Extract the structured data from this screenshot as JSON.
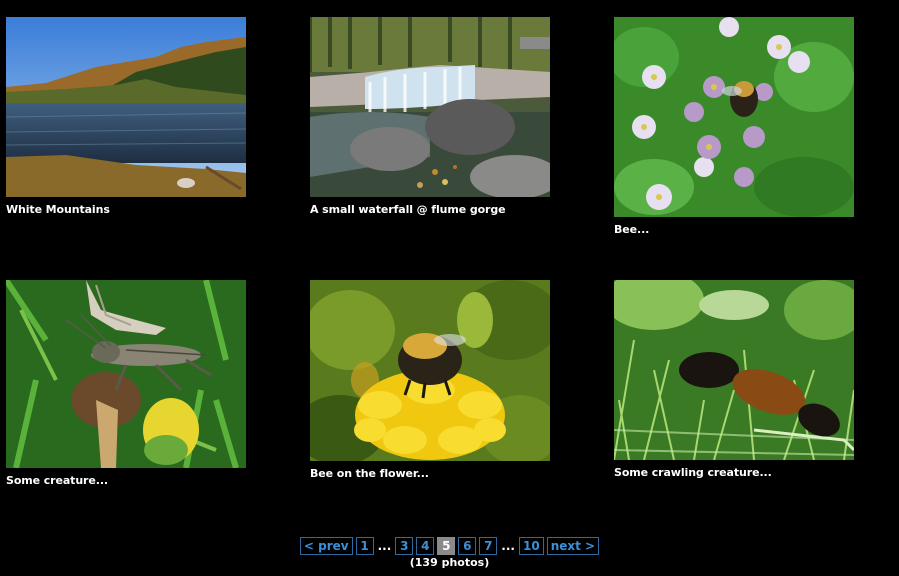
{
  "photos": [
    {
      "caption": "White Mountains",
      "alt": "Lake with autumn foliage and blue sky"
    },
    {
      "caption": "A small waterfall @ flume gorge",
      "alt": "Small waterfall over rocks"
    },
    {
      "caption": "Bee...",
      "alt": "Bee on purple flowers"
    },
    {
      "caption": "Some creature...",
      "alt": "Grasshopper on a dried flower"
    },
    {
      "caption": "Bee on the flower...",
      "alt": "Bee on a yellow marigold"
    },
    {
      "caption": "Some crawling creature...",
      "alt": "Woolly bear caterpillar in grass"
    }
  ],
  "pager": {
    "prev": "< prev",
    "pages": [
      "1",
      "3",
      "4",
      "5",
      "6",
      "7",
      "10"
    ],
    "current": "5",
    "ellipsis": "...",
    "next": "next >",
    "count": "(139 photos)"
  }
}
